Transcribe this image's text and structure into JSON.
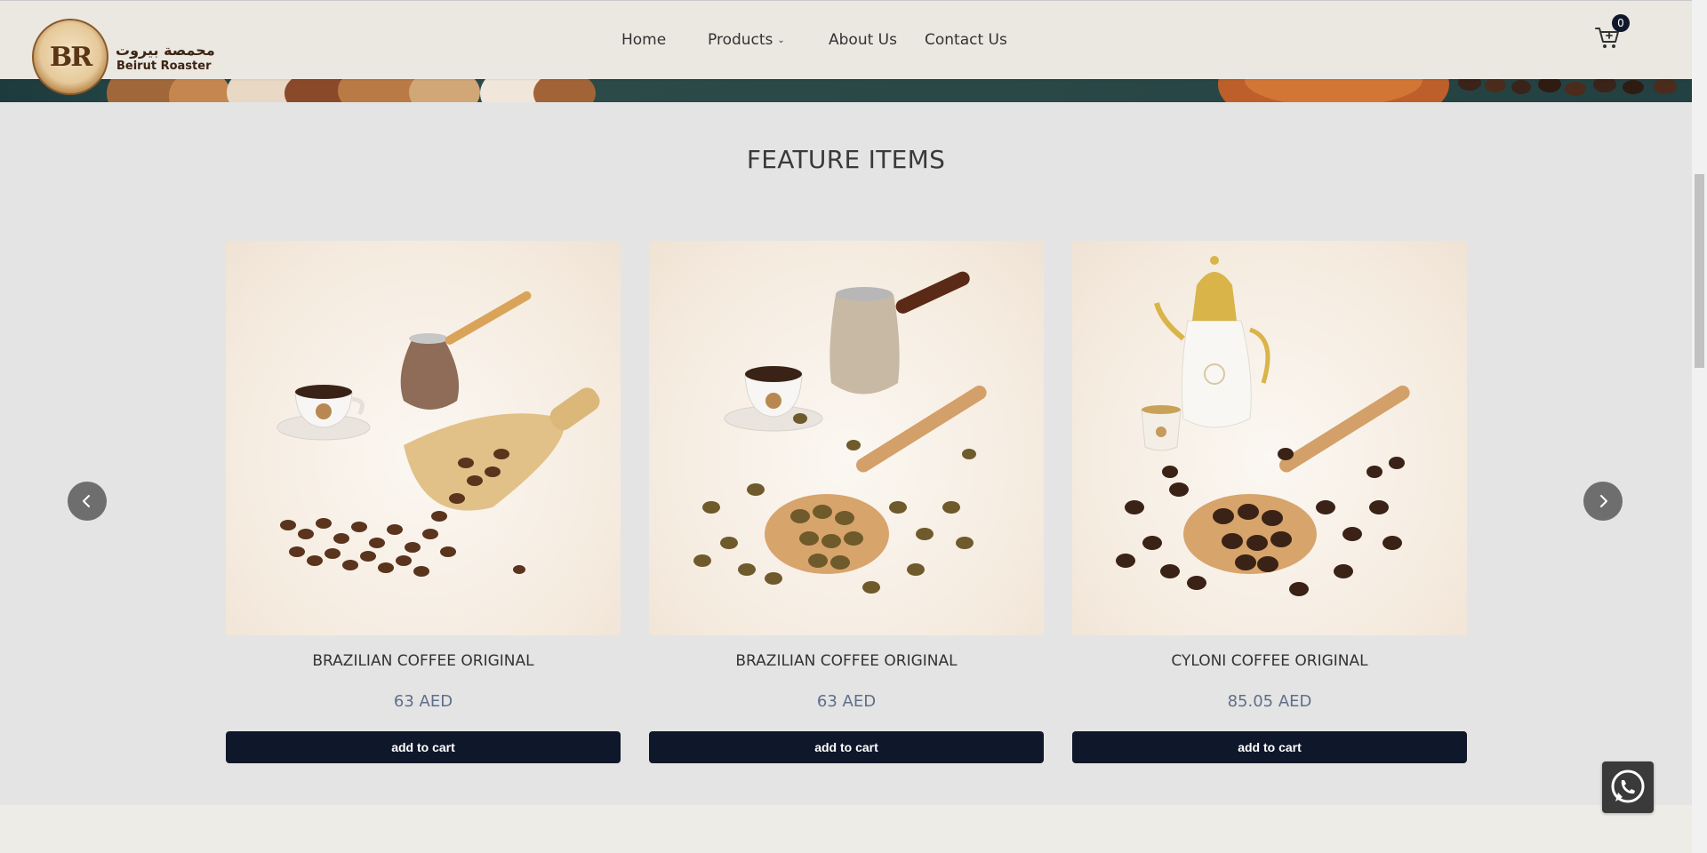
{
  "header": {
    "logo_monogram": "BR",
    "logo_arabic": "محمصة بيروت",
    "logo_english": "Beirut Roaster",
    "nav": [
      {
        "label": "Home"
      },
      {
        "label": "Products"
      },
      {
        "label": "About Us"
      },
      {
        "label": "Contact Us"
      }
    ],
    "cart_count": "0"
  },
  "feature": {
    "title": "FEATURE ITEMS",
    "products": [
      {
        "name": "BRAZILIAN COFFEE ORIGINAL",
        "price": "63 AED",
        "button": "add to cart"
      },
      {
        "name": "BRAZILIAN COFFEE ORIGINAL",
        "price": "63 AED",
        "button": "add to cart"
      },
      {
        "name": "CYLONI COFFEE ORIGINAL",
        "price": "85.05 AED",
        "button": "add to cart"
      }
    ]
  },
  "icons": {
    "cart": "shopping-cart-icon",
    "prev": "chevron-left-icon",
    "next": "chevron-right-icon",
    "chat": "whatsapp-icon"
  },
  "colors": {
    "button_bg": "#0f172a",
    "price_text": "#5f6f8a",
    "header_bg": "#ebe8e2",
    "section_bg": "#e4e4e4"
  }
}
